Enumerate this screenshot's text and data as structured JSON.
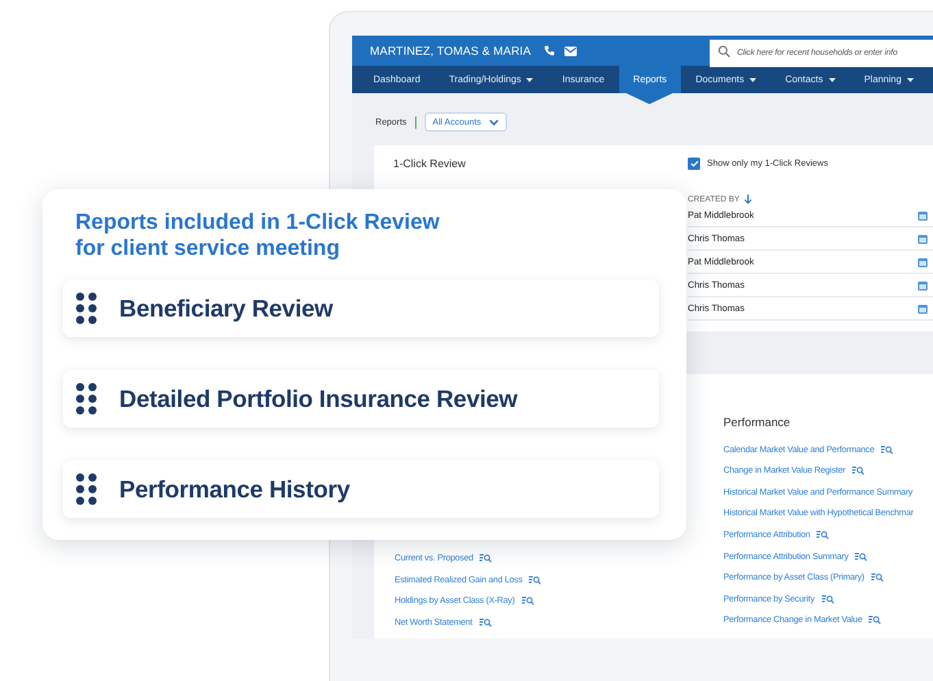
{
  "header": {
    "client_name": "MARTINEZ, TOMAS & MARIA",
    "search": {
      "placeholder": "Click here for recent households or enter info"
    }
  },
  "nav_tabs": [
    {
      "label": "Dashboard",
      "dropdown": false,
      "selected": false
    },
    {
      "label": "Trading/Holdings",
      "dropdown": true,
      "selected": false
    },
    {
      "label": "Insurance",
      "dropdown": false,
      "selected": false
    },
    {
      "label": "Reports",
      "dropdown": false,
      "selected": true
    },
    {
      "label": "Documents",
      "dropdown": true,
      "selected": false
    },
    {
      "label": "Contacts",
      "dropdown": true,
      "selected": false
    },
    {
      "label": "Planning",
      "dropdown": true,
      "selected": false
    }
  ],
  "breadcrumb": {
    "label": "Reports",
    "account_filter": "All Accounts"
  },
  "one_click_review": {
    "title": "1-Click Review",
    "show_only_mine": {
      "label": "Show only my 1-Click Reviews",
      "checked": true
    },
    "created_by_column": "CREATED BY",
    "rows": [
      {
        "created_by": "Pat Middlebrook"
      },
      {
        "created_by": "Chris Thomas"
      },
      {
        "created_by": "Pat Middlebrook"
      },
      {
        "created_by": "Chris Thomas"
      },
      {
        "created_by": "Chris Thomas"
      }
    ]
  },
  "report_library": {
    "left_column": [
      {
        "name": "Current vs. Proposed",
        "preview_icon": true
      },
      {
        "name": "Estimated Realized Gain and Loss",
        "preview_icon": true
      },
      {
        "name": "Holdings by Asset Class (X-Ray)",
        "preview_icon": true
      },
      {
        "name": "Net Worth Statement",
        "preview_icon": true
      }
    ],
    "performance": {
      "heading": "Performance",
      "reports": [
        {
          "name": "Calendar Market Value and Performance",
          "preview_icon": true
        },
        {
          "name": "Change in Market Value Register",
          "preview_icon": true
        },
        {
          "name": "Historical Market Value and Performance Summary",
          "preview_icon": false
        },
        {
          "name": "Historical Market Value with Hypothetical Benchmar",
          "preview_icon": false
        },
        {
          "name": "Performance Attribution",
          "preview_icon": true
        },
        {
          "name": "Performance Attribution Summary",
          "preview_icon": true
        },
        {
          "name": "Performance by Asset Class (Primary)",
          "preview_icon": true
        },
        {
          "name": "Performance by Security",
          "preview_icon": true
        },
        {
          "name": "Performance Change in Market Value",
          "preview_icon": true
        }
      ]
    }
  },
  "overlay": {
    "heading": "Reports included in 1-Click Review for client service meeting",
    "items": [
      {
        "label": "Beneficiary Review"
      },
      {
        "label": "Detailed Portfolio Insurance Review"
      },
      {
        "label": "Performance History"
      }
    ]
  }
}
